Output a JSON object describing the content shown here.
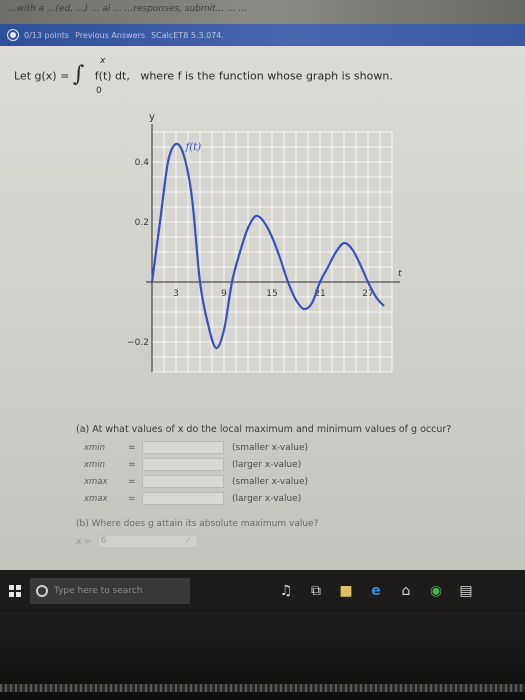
{
  "browser": {
    "top_text": "...with a ...(ed, ...) ... al ... ...responses, submit... ... ...",
    "hw_points": "0/13 points",
    "hw_prev": "Previous Answers",
    "hw_code": "SCalcET8 5.3.074."
  },
  "question": {
    "prefix": "Let  g(x) =",
    "integral_sign": "∫",
    "upper_limit": "x",
    "lower_limit": "0",
    "integrand": "f(t) dt,",
    "suffix": "where f is the function whose graph is shown."
  },
  "chart_data": {
    "type": "line",
    "xlabel": "t",
    "ylabel": "y",
    "curve_label": "f(t)",
    "x_tick_labels": [
      "3",
      "9",
      "15",
      "21",
      "27"
    ],
    "y_tick_labels": [
      "0.4",
      "0.2",
      "−0.2"
    ],
    "x_ticks": [
      3,
      9,
      15,
      21,
      27
    ],
    "y_ticks": [
      0.4,
      0.2,
      -0.2
    ],
    "xlim": [
      0,
      30
    ],
    "ylim": [
      -0.3,
      0.5
    ],
    "grid": true,
    "series": [
      {
        "x": [
          0,
          1,
          2,
          3,
          4,
          5,
          6,
          7,
          8,
          9,
          10,
          11,
          12,
          13,
          14,
          15,
          16,
          17,
          18,
          19,
          20,
          21,
          22,
          23,
          24,
          25,
          26,
          27,
          28,
          29
        ],
        "y": [
          0,
          0.2,
          0.4,
          0.46,
          0.42,
          0.28,
          0,
          -0.14,
          -0.22,
          -0.16,
          0,
          0.1,
          0.18,
          0.22,
          0.2,
          0.15,
          0.08,
          0,
          -0.06,
          -0.09,
          -0.07,
          0,
          0.05,
          0.1,
          0.13,
          0.11,
          0.06,
          0,
          -0.05,
          -0.08
        ]
      }
    ]
  },
  "part_a": {
    "heading": "(a) At what values of x do the local maximum and minimum values of g occur?",
    "rows": [
      {
        "var": "xmin",
        "eq": "=",
        "note": "(smaller x-value)"
      },
      {
        "var": "xmin",
        "eq": "=",
        "note": "(larger x-value)"
      },
      {
        "var": "xmax",
        "eq": "=",
        "note": "(smaller x-value)"
      },
      {
        "var": "xmax",
        "eq": "=",
        "note": "(larger x-value)"
      }
    ]
  },
  "part_b": {
    "heading": "(b) Where does g attain its absolute maximum value?",
    "answer_prefix": "x =",
    "answer_value": "6",
    "check": "✓"
  },
  "taskbar": {
    "search_placeholder": "Type here to search",
    "mic": "♫",
    "taskview": "⧉",
    "folder": "■",
    "edge": "e",
    "home": "⌂",
    "chrome": "◉",
    "store": "▤"
  },
  "colors": {
    "curve": "#3a4fc0",
    "grid": "#ffffff",
    "hwbar": "#3a5aa2"
  }
}
